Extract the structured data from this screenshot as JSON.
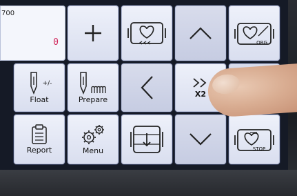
{
  "counter": {
    "title": "700",
    "value": "0"
  },
  "buttons": {
    "float_label": "Float",
    "float_caption": "+/-",
    "prepare_label": "Prepare",
    "report_label": "Report",
    "menu_label": "Menu",
    "speed_label": "X2",
    "speed_symbol": ">>",
    "origin_caption": "ORG",
    "stop_caption": "STOP"
  },
  "colors": {
    "screen": "#151a26",
    "button": "#e6eaf6",
    "counter_value": "#d0265a"
  },
  "icons": [
    "plus-icon",
    "frame-back-icon",
    "up-arrow-icon",
    "frame-origin-icon",
    "needle-float-icon",
    "needle-prepare-icon",
    "left-arrow-icon",
    "fast-forward-icon",
    "right-arrow-icon",
    "clipboard-icon",
    "gears-icon",
    "frame-down-icon",
    "down-arrow-icon",
    "frame-stop-icon"
  ]
}
